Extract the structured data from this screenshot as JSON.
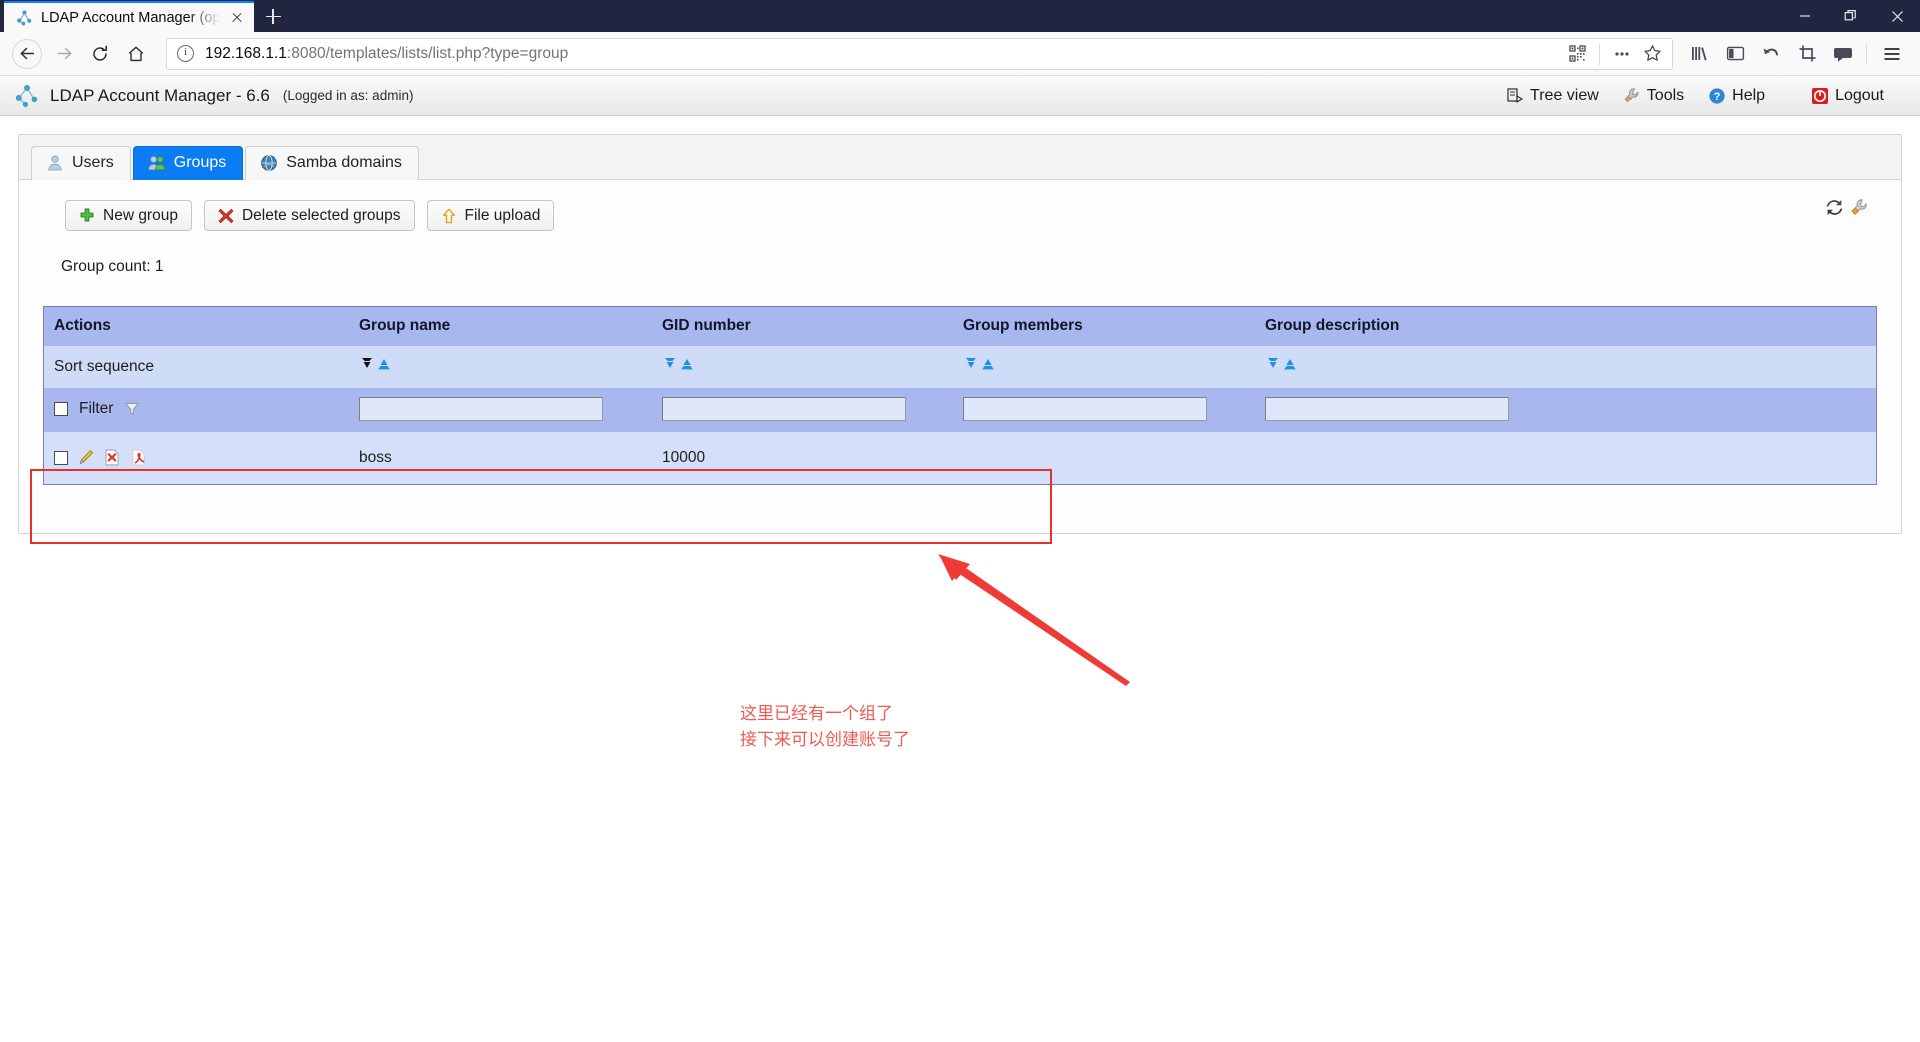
{
  "browser": {
    "tab": {
      "title": "LDAP Account Manager (ope",
      "favicon": "ldap-tree-icon"
    },
    "new_tab_label": "+",
    "window_controls": [
      "minimize",
      "restore",
      "close"
    ],
    "nav": {
      "back": "back-arrow",
      "forward": "forward-arrow",
      "reload": "reload-icon",
      "home": "home-icon"
    },
    "url": {
      "host": "192.168.1.1",
      "rest": ":8080/templates/lists/list.php?type=group",
      "full": "192.168.1.1:8080/templates/lists/list.php?type=group"
    },
    "url_icons": [
      "qr-code-icon",
      "page-actions-ellipsis-icon",
      "bookmark-star-icon"
    ],
    "toolbar_icons": [
      "library-icon",
      "sidebar-icon",
      "undo-icon",
      "screenshot-crop-icon",
      "pocket-icon",
      "app-menu-icon"
    ]
  },
  "app": {
    "title": "LDAP Account Manager - 6.6",
    "logged_in_as": "(Logged in as: admin)",
    "nav": [
      {
        "label": "Tree view",
        "icon": "tree-view-icon"
      },
      {
        "label": "Tools",
        "icon": "wrench-icon"
      },
      {
        "label": "Help",
        "icon": "help-question-icon"
      },
      {
        "label": "Logout",
        "icon": "logout-icon"
      }
    ]
  },
  "tabs": [
    {
      "label": "Users",
      "icon": "user-icon",
      "active": false
    },
    {
      "label": "Groups",
      "icon": "group-icon",
      "active": true
    },
    {
      "label": "Samba domains",
      "icon": "globe-icon",
      "active": false
    }
  ],
  "toolbar": {
    "new_group": "New group",
    "delete_selected": "Delete selected groups",
    "file_upload": "File upload",
    "refresh_icon": "refresh-icon",
    "settings_icon": "wrench-icon"
  },
  "group_count": "Group count: 1",
  "table": {
    "headers": [
      "Actions",
      "Group name",
      "GID number",
      "Group members",
      "Group description"
    ],
    "sort_label": "Sort sequence",
    "filter_label": "Filter",
    "filter_values": [
      "",
      "",
      "",
      ""
    ],
    "filter_placeholder": "",
    "sort_states": [
      {
        "down": "active",
        "up": "normal"
      },
      {
        "down": "normal",
        "up": "normal"
      },
      {
        "down": "normal",
        "up": "normal"
      },
      {
        "down": "normal",
        "up": "normal"
      }
    ],
    "rows": [
      {
        "actions": [
          "edit-pencil-icon",
          "delete-x-icon",
          "pdf-icon"
        ],
        "group_name": "boss",
        "gid_number": "10000",
        "group_members": "",
        "group_description": ""
      }
    ]
  },
  "annotation": {
    "text_line1": "这里已经有一个组了",
    "text_line2": "接下来可以创建账号了",
    "color": "#f05a52",
    "highlight_color": "#e8302a"
  }
}
